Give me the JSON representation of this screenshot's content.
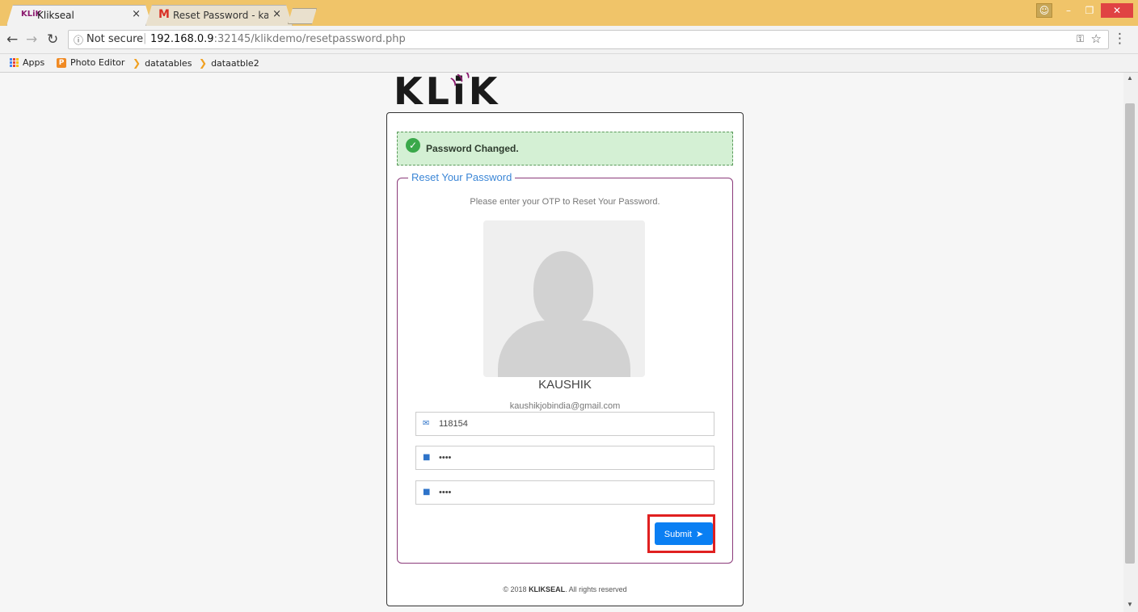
{
  "browser": {
    "tabs": [
      {
        "favicon": "KLiK",
        "title": "Klikseal",
        "active": true
      },
      {
        "favicon": "M",
        "title": "Reset Password - kaushi",
        "active": false
      }
    ],
    "close_glyph": "×",
    "address": {
      "info_icon": "ⓘ",
      "security_label": "Not secure",
      "host": "192.168.0.9",
      "path": ":32145/klikdemo/resetpassword.php"
    },
    "bookmarks": [
      {
        "label": "Apps",
        "icon": "apps-grid-icon"
      },
      {
        "label": "Photo Editor",
        "icon": "photo-editor-icon"
      },
      {
        "label": "datatables",
        "icon": "datatables-icon"
      },
      {
        "label": "dataatble2",
        "icon": "datatables-icon"
      }
    ]
  },
  "page": {
    "logo_text": "KLiK",
    "alert": {
      "message": "Password Changed.",
      "color": "#d4f0d4"
    },
    "form": {
      "legend": "Reset Your Password",
      "instruction": "Please enter your OTP to Reset Your Password.",
      "user_name": "KAUSHIK",
      "user_email": "kaushikjobindia@gmail.com",
      "otp_value": "118154",
      "password_value": "••••",
      "confirm_password_value": "••••",
      "submit_label": "Submit"
    },
    "footer": {
      "prefix": "© 2018 ",
      "brand": "KLIKSEAL",
      "suffix": ". All rights reserved"
    }
  },
  "colors": {
    "accent": "#0a7ff3",
    "highlight": "#e02020",
    "brand": "#8b1a6f",
    "tabstrip": "#f0c469"
  }
}
